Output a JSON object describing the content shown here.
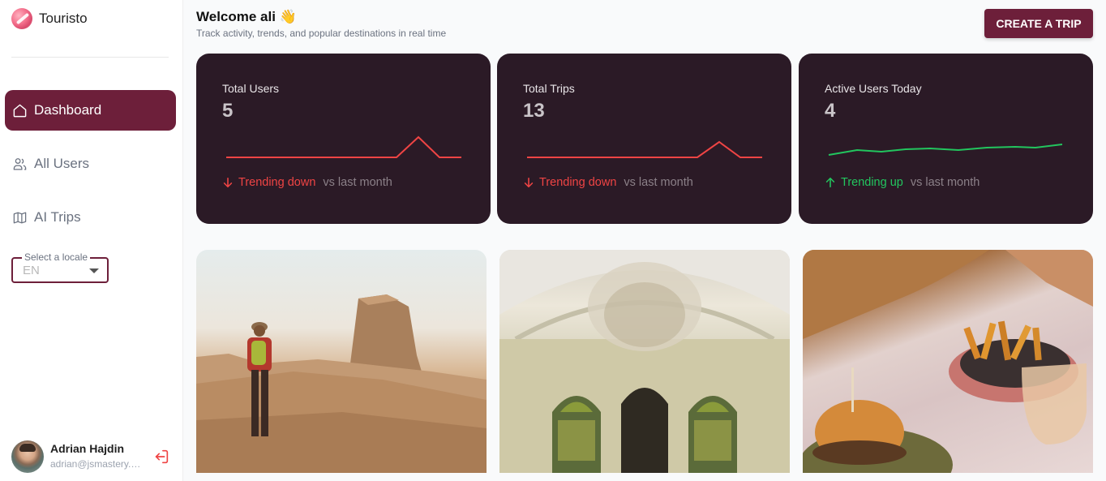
{
  "brand": {
    "name": "Touristo"
  },
  "nav": [
    {
      "label": "Dashboard",
      "icon": "home-icon",
      "active": true
    },
    {
      "label": "All Users",
      "icon": "users-icon",
      "active": false
    },
    {
      "label": "AI Trips",
      "icon": "map-icon",
      "active": false
    }
  ],
  "locale": {
    "label": "Select a locale",
    "value": "EN"
  },
  "profile": {
    "name": "Adrian Hajdin",
    "email": "adrian@jsmastery.pro"
  },
  "header": {
    "title": "Welcome ali 👋",
    "subtitle": "Track activity, trends, and popular destinations in real time",
    "create_button": "CREATE A TRIP"
  },
  "stats": [
    {
      "label": "Total Users",
      "value": "5",
      "trend_text": "Trending down",
      "trend_dir": "down",
      "vs": "vs last month"
    },
    {
      "label": "Total Trips",
      "value": "13",
      "trend_text": "Trending down",
      "trend_dir": "down",
      "vs": "vs last month"
    },
    {
      "label": "Active Users Today",
      "value": "4",
      "trend_text": "Trending up",
      "trend_dir": "up",
      "vs": "vs last month"
    }
  ],
  "colors": {
    "accent": "#6d1f3a",
    "card_bg": "#2b1a26",
    "trend_down": "#ef4444",
    "trend_up": "#22c55e"
  }
}
